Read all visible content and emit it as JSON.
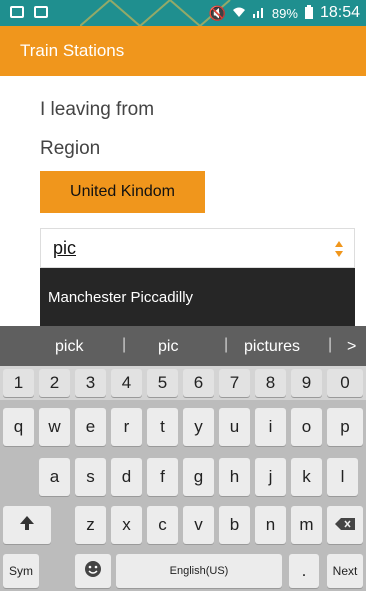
{
  "status_bar": {
    "battery": "89%",
    "time": "18:54"
  },
  "app_bar": {
    "title": "Train Stations"
  },
  "form": {
    "leaving_label": "I leaving from",
    "region_label": "Region",
    "region_value": "United Kindom",
    "search_value": "pic"
  },
  "autocomplete": {
    "suggestion": "Manchester Piccadilly"
  },
  "keyboard": {
    "predictions": [
      "pick",
      "pic",
      "pictures"
    ],
    "more_indicator": ">",
    "number_row": [
      "1",
      "2",
      "3",
      "4",
      "5",
      "6",
      "7",
      "8",
      "9",
      "0"
    ],
    "row1": [
      "q",
      "w",
      "e",
      "r",
      "t",
      "y",
      "u",
      "i",
      "o",
      "p"
    ],
    "row2": [
      "a",
      "s",
      "d",
      "f",
      "g",
      "h",
      "j",
      "k",
      "l"
    ],
    "row3": [
      "z",
      "x",
      "c",
      "v",
      "b",
      "n",
      "m"
    ],
    "sym_label": "Sym",
    "language_label": "English(US)",
    "period_label": ".",
    "next_label": "Next"
  },
  "colors": {
    "accent": "#f0961c",
    "status_bar": "#1f8f8f",
    "suggestion_bg": "#262626",
    "keyboard_bg": "#bcbcbc"
  },
  "icons": [
    "email-icon",
    "image-icon",
    "mute-icon",
    "wifi-icon",
    "signal-icon",
    "battery-icon",
    "spinner-arrows-icon",
    "shift-icon",
    "backspace-icon",
    "emoji-icon",
    "mic-icon"
  ]
}
